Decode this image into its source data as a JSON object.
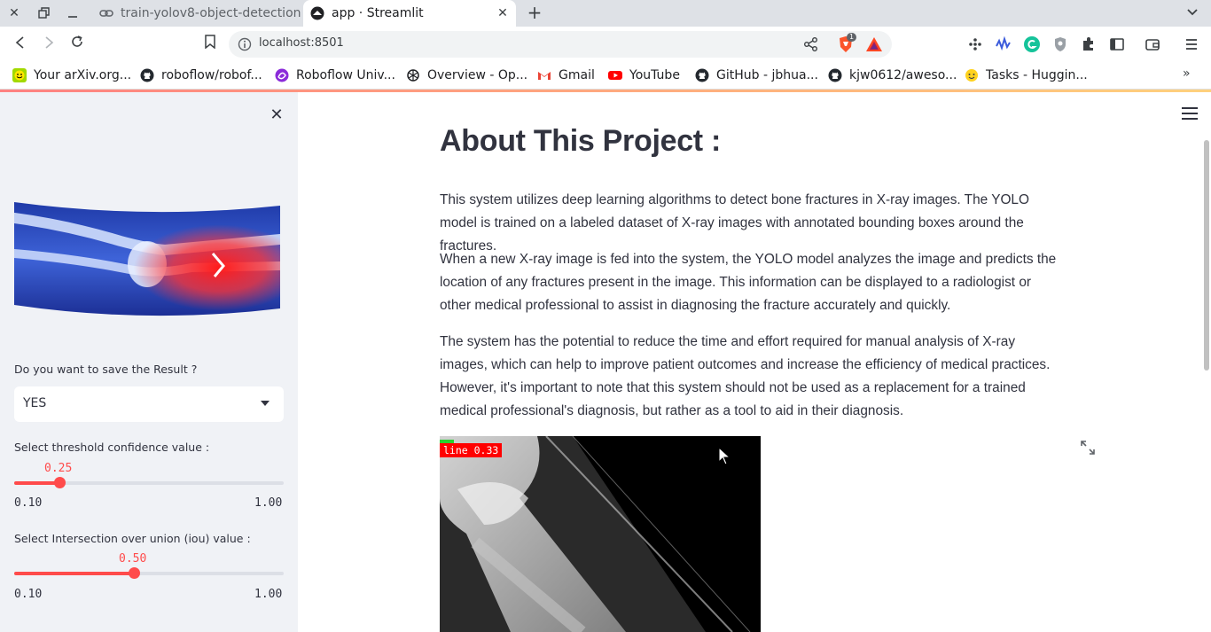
{
  "browser": {
    "tabs": [
      {
        "title": "train-yolov8-object-detection",
        "active": false
      },
      {
        "title": "app · Streamlit",
        "active": true
      }
    ],
    "address": "localhost:8501",
    "brave_badge": "1"
  },
  "bookmarks": [
    "Your arXiv.org...",
    "roboflow/robof...",
    "Roboflow Univ...",
    "Overview - Op...",
    "Gmail",
    "YouTube",
    "GitHub - jbhua...",
    "kjw0612/aweso...",
    "Tasks - Huggin..."
  ],
  "sidebar": {
    "save_label": "Do you want to save the Result ?",
    "save_value": "YES",
    "threshold": {
      "label": "Select threshold confidence value :",
      "value": "0.25",
      "fraction": 0.1667,
      "min": "0.10",
      "max": "1.00"
    },
    "iou": {
      "label": "Select Intersection over union (iou) value :",
      "value": "0.50",
      "fraction": 0.4444,
      "min": "0.10",
      "max": "1.00"
    }
  },
  "main": {
    "title": "About This Project :",
    "paragraphs": [
      "This system utilizes deep learning algorithms to detect bone fractures in X-ray images. The YOLO model is trained on a labeled dataset of X-ray images with annotated bounding boxes around the fractures.",
      "When a new X-ray image is fed into the system, the YOLO model analyzes the image and predicts the location of any fractures present in the image. This information can be displayed to a radiologist or other medical professional to assist in diagnosing the fracture accurately and quickly.",
      "The system has the potential to reduce the time and effort required for manual analysis of X-ray images, which can help to improve patient outcomes and increase the efficiency of medical practices. However, it's important to note that this system should not be used as a replacement for a trained medical professional's diagnosis, but rather as a tool to aid in their diagnosis."
    ],
    "detection_label": "line 0.33"
  },
  "colors": {
    "accent": "#ff4b4b",
    "sidebar_bg": "#f0f2f6",
    "text": "#31333f"
  }
}
